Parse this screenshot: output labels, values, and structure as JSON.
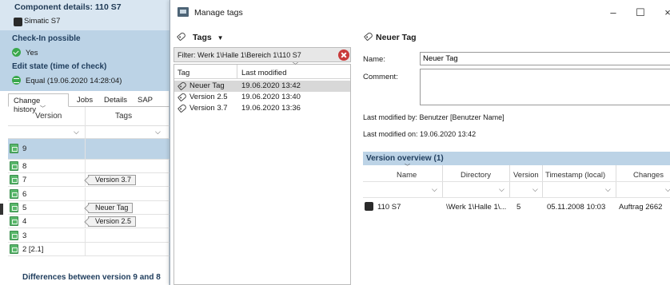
{
  "left": {
    "title": "Component details: 110 S7",
    "subtitle": "Simatic S7",
    "checkin_label": "Check-In possible",
    "checkin_value": "Yes",
    "edit_label": "Edit state (time of check)",
    "edit_value": "Equal (19.06.2020 14:28:04)",
    "tabs": [
      "Change history",
      "Jobs",
      "Details",
      "SAP"
    ],
    "col_version": "Version",
    "col_tags": "Tags",
    "versions": [
      {
        "v": "9",
        "tag": ""
      },
      {
        "v": "8",
        "tag": ""
      },
      {
        "v": "7",
        "tag": "Version 3.7"
      },
      {
        "v": "6",
        "tag": ""
      },
      {
        "v": "5",
        "tag": "Neuer Tag"
      },
      {
        "v": "4",
        "tag": "Version 2.5"
      },
      {
        "v": "3",
        "tag": ""
      },
      {
        "v": "2 [2.1]",
        "tag": ""
      }
    ],
    "footer": "Differences between version 9 and 8"
  },
  "dialog": {
    "title": "Manage tags",
    "controls": {
      "minimize": "–",
      "maximize": "☐",
      "close": "×"
    },
    "tags_button": "Tags",
    "filter": "Filter:  Werk 1\\Halle 1\\Bereich 1\\110 S7",
    "list_headers": {
      "tag": "Tag",
      "modified": "Last modified"
    },
    "tags": [
      {
        "name": "Neuer Tag",
        "date": "19.06.2020 13:42"
      },
      {
        "name": "Version 2.5",
        "date": "19.06.2020 13:40"
      },
      {
        "name": "Version 3.7",
        "date": "19.06.2020 13:36"
      }
    ],
    "detail": {
      "title": "Neuer Tag",
      "name_label": "Name:",
      "name_value": "Neuer Tag",
      "comment_label": "Comment:",
      "comment_value": "",
      "modified_by": "Last modified by:  Benutzer [Benutzer Name]",
      "modified_on": "Last modified on:  19.06.2020 13:42"
    },
    "overview": {
      "title": "Version overview (1)",
      "headers": [
        "Name",
        "Directory",
        "Version",
        "Timestamp (local)",
        "Changes"
      ],
      "rows": [
        {
          "name": "110 S7",
          "directory": "\\Werk 1\\Halle 1\\...",
          "version": "5",
          "timestamp": "05.11.2008 10:03",
          "changes": "Auftrag 2662"
        }
      ]
    }
  },
  "colors": {
    "accent_light": "#bcd3e6",
    "accent_header": "#d9e6f1",
    "ok_green": "#3aa84c",
    "error_red": "#c93b3b"
  }
}
